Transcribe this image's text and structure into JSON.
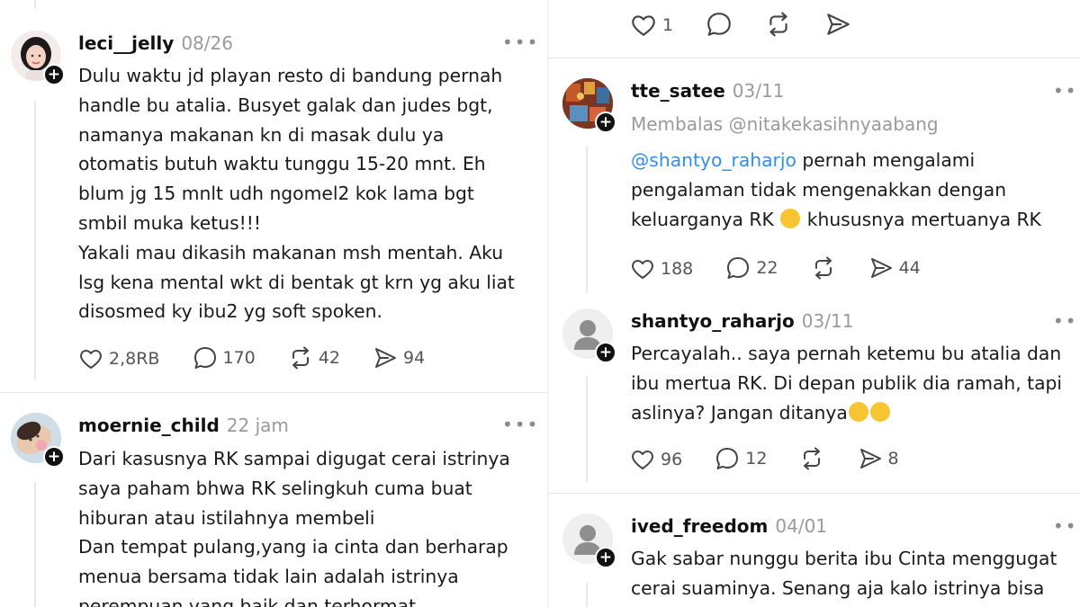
{
  "left_column": {
    "posts": [
      {
        "username": "leci__jelly",
        "date": "08/26",
        "text_lines": [
          "Dulu waktu jd playan resto di bandung pernah",
          "handle bu atalia. Busyet galak dan judes bgt,",
          "namanya makanan kn di masak dulu ya",
          "otomatis butuh waktu tunggu 15-20 mnt. Eh",
          "blum jg 15 mnlt udh ngomel2 kok lama bgt",
          "smbil muka ketus!!!",
          "Yakali mau dikasih makanan msh mentah. Aku",
          "lsg kena mental wkt di bentak gt krn yg aku liat",
          "disosmed ky ibu2 yg soft spoken."
        ],
        "likes": "2,8RB",
        "comments": "170",
        "reposts": "42",
        "shares": "94"
      },
      {
        "username": "moernie_child",
        "date": "22 jam",
        "text_lines": [
          "Dari kasusnya RK sampai digugat cerai istrinya",
          "saya paham bhwa RK selingkuh cuma buat",
          "hiburan atau istilahnya membeli",
          "Dan tempat pulang,yang ia cinta dan berharap",
          "menua bersama tidak lain adalah istrinya",
          "perempuan yang baik dan terhormat"
        ]
      }
    ]
  },
  "right_column": {
    "top_actions": {
      "likes": "1"
    },
    "posts": [
      {
        "username": "tte_satee",
        "date": "03/11",
        "reply_to": "Membalas @nitakekasihnyaabang",
        "mention": "@shantyo_raharjo",
        "line1_rest": "pernah mengalami",
        "line2": "pengalaman tidak mengenakkan dengan",
        "line3_a": "keluarganya RK",
        "line3_b": "khususnya mertuanya RK",
        "likes": "188",
        "comments": "22",
        "shares": "44"
      },
      {
        "username": "shantyo_raharjo",
        "date": "03/11",
        "line1": "Percayalah.. saya pernah ketemu bu atalia dan",
        "line2": "ibu mertua RK. Di depan publik dia ramah,  tapi",
        "line3": "aslinya? Jangan ditanya",
        "likes": "96",
        "comments": "12",
        "shares": "8"
      },
      {
        "username": "ived_freedom",
        "date": "04/01",
        "text_lines": [
          "Gak sabar nunggu berita ibu Cinta menggugat",
          "cerai suaminya. Senang aja kalo istrinya bisa"
        ]
      }
    ]
  },
  "ui": {
    "more_label": "•••",
    "plus_label": "+"
  },
  "icons": {
    "like": "heart-outline-icon",
    "comment": "speech-bubble-icon",
    "repost": "repost-arrows-icon",
    "share": "send-plane-icon",
    "plus": "follow-plus-icon",
    "more": "more-dots-icon",
    "emoji": "rolling-laughing-emoji"
  },
  "colors": {
    "mention": "#2f8ff0",
    "muted": "#9a9a9a",
    "badge": "#111111",
    "emoji": "#f7c531"
  }
}
